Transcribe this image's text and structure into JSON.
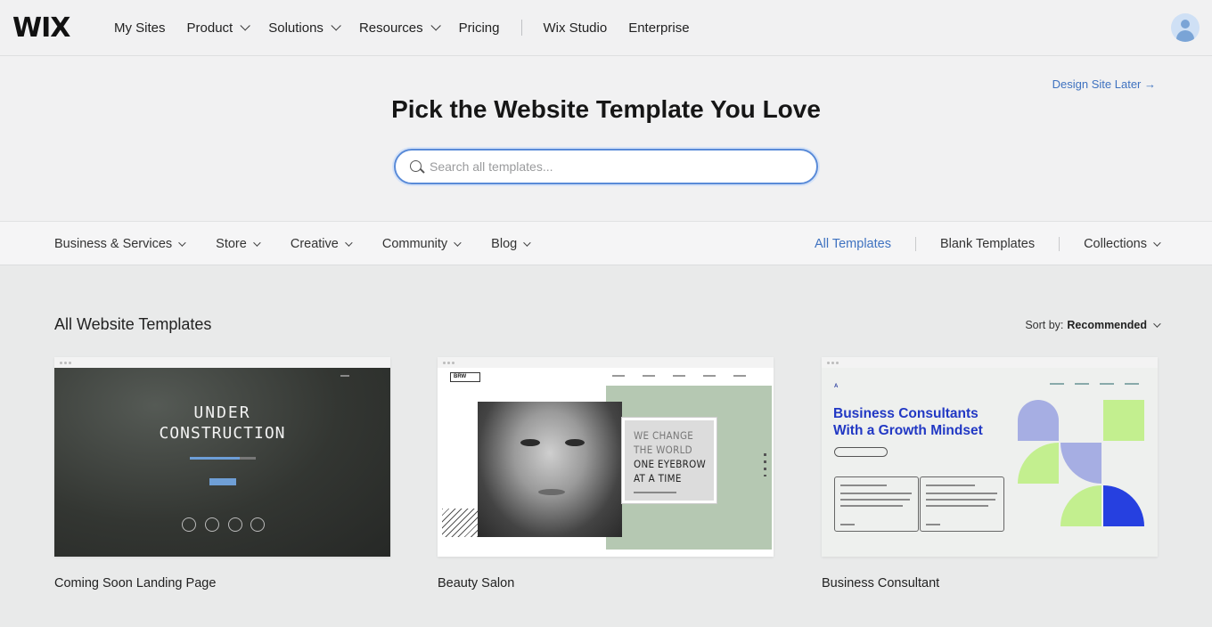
{
  "brand": {
    "logo": "WIX"
  },
  "nav": {
    "links": [
      {
        "label": "My Sites",
        "dropdown": false
      },
      {
        "label": "Product",
        "dropdown": true
      },
      {
        "label": "Solutions",
        "dropdown": true
      },
      {
        "label": "Resources",
        "dropdown": true
      },
      {
        "label": "Pricing",
        "dropdown": false
      }
    ],
    "links_after_separator": [
      {
        "label": "Wix Studio"
      },
      {
        "label": "Enterprise"
      }
    ],
    "avatar_icon": "user-avatar-icon"
  },
  "hero": {
    "design_later": "Design Site Later →",
    "title": "Pick the Website Template You Love",
    "search_placeholder": "Search all templates..."
  },
  "categories": {
    "left": [
      "Business & Services",
      "Store",
      "Creative",
      "Community",
      "Blog"
    ],
    "right": [
      {
        "label": "All Templates",
        "active": true
      },
      {
        "label": "Blank Templates",
        "active": false
      },
      {
        "label": "Collections",
        "active": false
      }
    ]
  },
  "main": {
    "section_title": "All Website Templates",
    "sort_label": "Sort by:",
    "sort_value": "Recommended",
    "templates": [
      {
        "name": "Coming Soon Landing Page",
        "preview_line1": "UNDER",
        "preview_line2": "CONSTRUCTION"
      },
      {
        "name": "Beauty Salon",
        "preview_logo": "BRW",
        "preview_lines": [
          "WE CHANGE",
          "THE WORLD",
          "ONE EYEBROW",
          "AT A TIME"
        ]
      },
      {
        "name": "Business Consultant",
        "preview_logo": "A",
        "preview_headline_1": "Business Consultants",
        "preview_headline_2": "With a Growth Mindset"
      }
    ]
  },
  "colors": {
    "accent": "#3f72c0",
    "consultant_blue": "#2138c4",
    "lime": "#c3ef8f",
    "lavender": "#a6aee3",
    "sage": "#b5c8b2"
  }
}
